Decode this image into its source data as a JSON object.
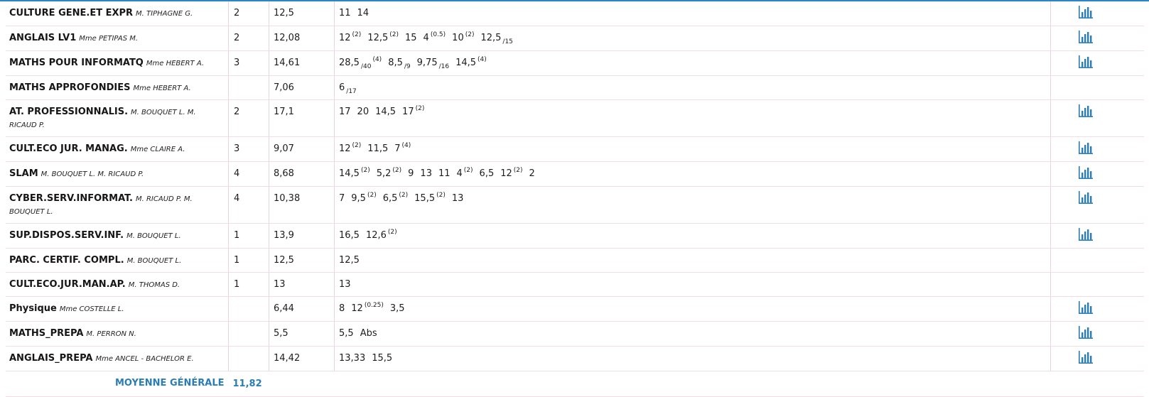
{
  "subjects": [
    {
      "name": "CULTURE GENE.ET EXPR",
      "teacher": "M. TIPHAGNE G.",
      "coef": "2",
      "avg": "12,5",
      "grades": [
        {
          "v": "11"
        },
        {
          "v": "14"
        }
      ],
      "chart": true
    },
    {
      "name": "ANGLAIS LV1",
      "teacher": "Mme PETIPAS M.",
      "coef": "2",
      "avg": "12,08",
      "grades": [
        {
          "v": "12",
          "sup": "(2)"
        },
        {
          "v": "12,5",
          "sup": "(2)"
        },
        {
          "v": "15"
        },
        {
          "v": "4",
          "sup": "(0.5)"
        },
        {
          "v": "10",
          "sup": "(2)"
        },
        {
          "v": "12,5",
          "sub": "/15"
        }
      ],
      "chart": true
    },
    {
      "name": "MATHS POUR INFORMATQ",
      "teacher": "Mme HEBERT A.",
      "coef": "3",
      "avg": "14,61",
      "grades": [
        {
          "v": "28,5",
          "sub": "/40",
          "sup": "(4)"
        },
        {
          "v": "8,5",
          "sub": "/9"
        },
        {
          "v": "9,75",
          "sub": "/16"
        },
        {
          "v": "14,5",
          "sup": "(4)"
        }
      ],
      "chart": true
    },
    {
      "name": "MATHS APPROFONDIES",
      "teacher": "Mme HEBERT A.",
      "coef": "",
      "avg": "7,06",
      "grades": [
        {
          "v": "6",
          "sub": "/17"
        }
      ],
      "chart": false
    },
    {
      "name": "AT. PROFESSIONNALIS.",
      "teacher": "M. BOUQUET L.     M. RICAUD P.",
      "coef": "2",
      "avg": "17,1",
      "grades": [
        {
          "v": "17"
        },
        {
          "v": "20"
        },
        {
          "v": "14,5"
        },
        {
          "v": "17",
          "sup": "(2)"
        }
      ],
      "chart": true
    },
    {
      "name": "CULT.ECO JUR. MANAG.",
      "teacher": "Mme CLAIRE A.",
      "coef": "3",
      "avg": "9,07",
      "grades": [
        {
          "v": "12",
          "sup": "(2)"
        },
        {
          "v": "11,5"
        },
        {
          "v": "7",
          "sup": "(4)"
        }
      ],
      "chart": true
    },
    {
      "name": "SLAM",
      "teacher": "M. BOUQUET L.     M. RICAUD P.",
      "coef": "4",
      "avg": "8,68",
      "grades": [
        {
          "v": "14,5",
          "sup": "(2)"
        },
        {
          "v": "5,2",
          "sup": "(2)"
        },
        {
          "v": "9"
        },
        {
          "v": "13"
        },
        {
          "v": "11"
        },
        {
          "v": "4",
          "sup": "(2)"
        },
        {
          "v": "6,5"
        },
        {
          "v": "12",
          "sup": "(2)"
        },
        {
          "v": "2"
        }
      ],
      "chart": true
    },
    {
      "name": "CYBER.SERV.INFORMAT.",
      "teacher": "M. RICAUD P.     M. BOUQUET L.",
      "coef": "4",
      "avg": "10,38",
      "grades": [
        {
          "v": "7"
        },
        {
          "v": "9,5",
          "sup": "(2)"
        },
        {
          "v": "6,5",
          "sup": "(2)"
        },
        {
          "v": "15,5",
          "sup": "(2)"
        },
        {
          "v": "13"
        }
      ],
      "chart": true
    },
    {
      "name": "SUP.DISPOS.SERV.INF.",
      "teacher": "M. BOUQUET L.",
      "coef": "1",
      "avg": "13,9",
      "grades": [
        {
          "v": "16,5"
        },
        {
          "v": "12,6",
          "sup": "(2)"
        }
      ],
      "chart": true
    },
    {
      "name": "PARC. CERTIF. COMPL.",
      "teacher": "M. BOUQUET L.",
      "coef": "1",
      "avg": "12,5",
      "grades": [
        {
          "v": "12,5"
        }
      ],
      "chart": false
    },
    {
      "name": "CULT.ECO.JUR.MAN.AP.",
      "teacher": "M. THOMAS D.",
      "coef": "1",
      "avg": "13",
      "grades": [
        {
          "v": "13"
        }
      ],
      "chart": false
    },
    {
      "name": "Physique",
      "teacher": "Mme COSTELLE L.",
      "coef": "",
      "avg": "6,44",
      "grades": [
        {
          "v": "8"
        },
        {
          "v": "12",
          "sup": "(0.25)"
        },
        {
          "v": "3,5"
        }
      ],
      "chart": true
    },
    {
      "name": "MATHS_PREPA",
      "teacher": "M. PERRON N.",
      "coef": "",
      "avg": "5,5",
      "grades": [
        {
          "v": "5,5"
        },
        {
          "v": "Abs"
        }
      ],
      "chart": true
    },
    {
      "name": "ANGLAIS_PREPA",
      "teacher": "Mme ANCEL - BACHELOR E.",
      "coef": "",
      "avg": "14,42",
      "grades": [
        {
          "v": "13,33"
        },
        {
          "v": "15,5"
        }
      ],
      "chart": true
    }
  ],
  "total": {
    "label": "MOYENNE GÉNÉRALE",
    "value": "11,82"
  },
  "colors": {
    "accent": "#2a86c8",
    "chart_icon": "#2a7db5",
    "row_border": "#f1dde3"
  },
  "icons": {
    "chart": "bar-chart-icon"
  }
}
